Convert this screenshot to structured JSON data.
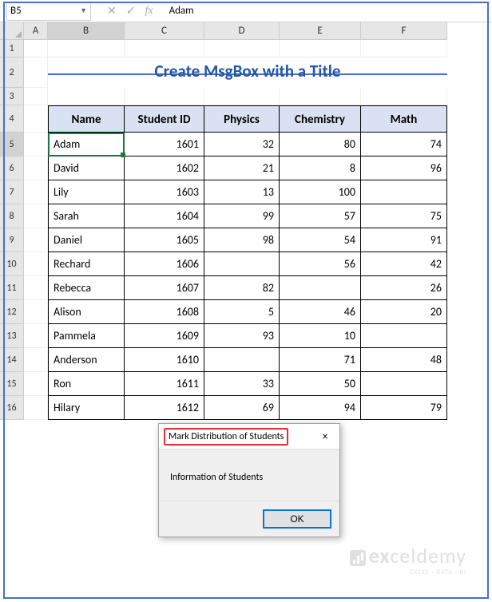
{
  "formula_bar": {
    "name_box": "B5",
    "formula_value": "Adam"
  },
  "columns": [
    "A",
    "B",
    "C",
    "D",
    "E",
    "F"
  ],
  "row_numbers": [
    1,
    2,
    3,
    4,
    5,
    6,
    7,
    8,
    9,
    10,
    11,
    12,
    13,
    14,
    15,
    16
  ],
  "title": "Create MsgBox with a Title",
  "headers": {
    "name": "Name",
    "student_id": "Student ID",
    "physics": "Physics",
    "chemistry": "Chemistry",
    "math": "Math"
  },
  "rows": [
    {
      "name": "Adam",
      "id": "1601",
      "physics": "32",
      "chemistry": "80",
      "math": "74"
    },
    {
      "name": "David",
      "id": "1602",
      "physics": "21",
      "chemistry": "8",
      "math": "96"
    },
    {
      "name": "Lily",
      "id": "1603",
      "physics": "13",
      "chemistry": "100",
      "math": ""
    },
    {
      "name": "Sarah",
      "id": "1604",
      "physics": "99",
      "chemistry": "57",
      "math": "75"
    },
    {
      "name": "Daniel",
      "id": "1605",
      "physics": "98",
      "chemistry": "54",
      "math": "91"
    },
    {
      "name": "Rechard",
      "id": "1606",
      "physics": "",
      "chemistry": "56",
      "math": "42"
    },
    {
      "name": "Rebecca",
      "id": "1607",
      "physics": "82",
      "chemistry": "",
      "math": "26"
    },
    {
      "name": "Alison",
      "id": "1608",
      "physics": "5",
      "chemistry": "46",
      "math": "20"
    },
    {
      "name": "Pammela",
      "id": "1609",
      "physics": "93",
      "chemistry": "10",
      "math": ""
    },
    {
      "name": "Anderson",
      "id": "1610",
      "physics": "",
      "chemistry": "71",
      "math": "48"
    },
    {
      "name": "Ron",
      "id": "1611",
      "physics": "33",
      "chemistry": "50",
      "math": ""
    },
    {
      "name": "Hilary",
      "id": "1612",
      "physics": "69",
      "chemistry": "94",
      "math": "79"
    }
  ],
  "msgbox": {
    "title": "Mark Distribution of Students",
    "body": "Information of Students",
    "ok": "OK",
    "close": "×"
  },
  "watermark": {
    "brand_prefix": "ex",
    "brand_suffix": "celdemy",
    "tagline": "EXCEL · DATA · BI"
  },
  "active_cell": "B5"
}
